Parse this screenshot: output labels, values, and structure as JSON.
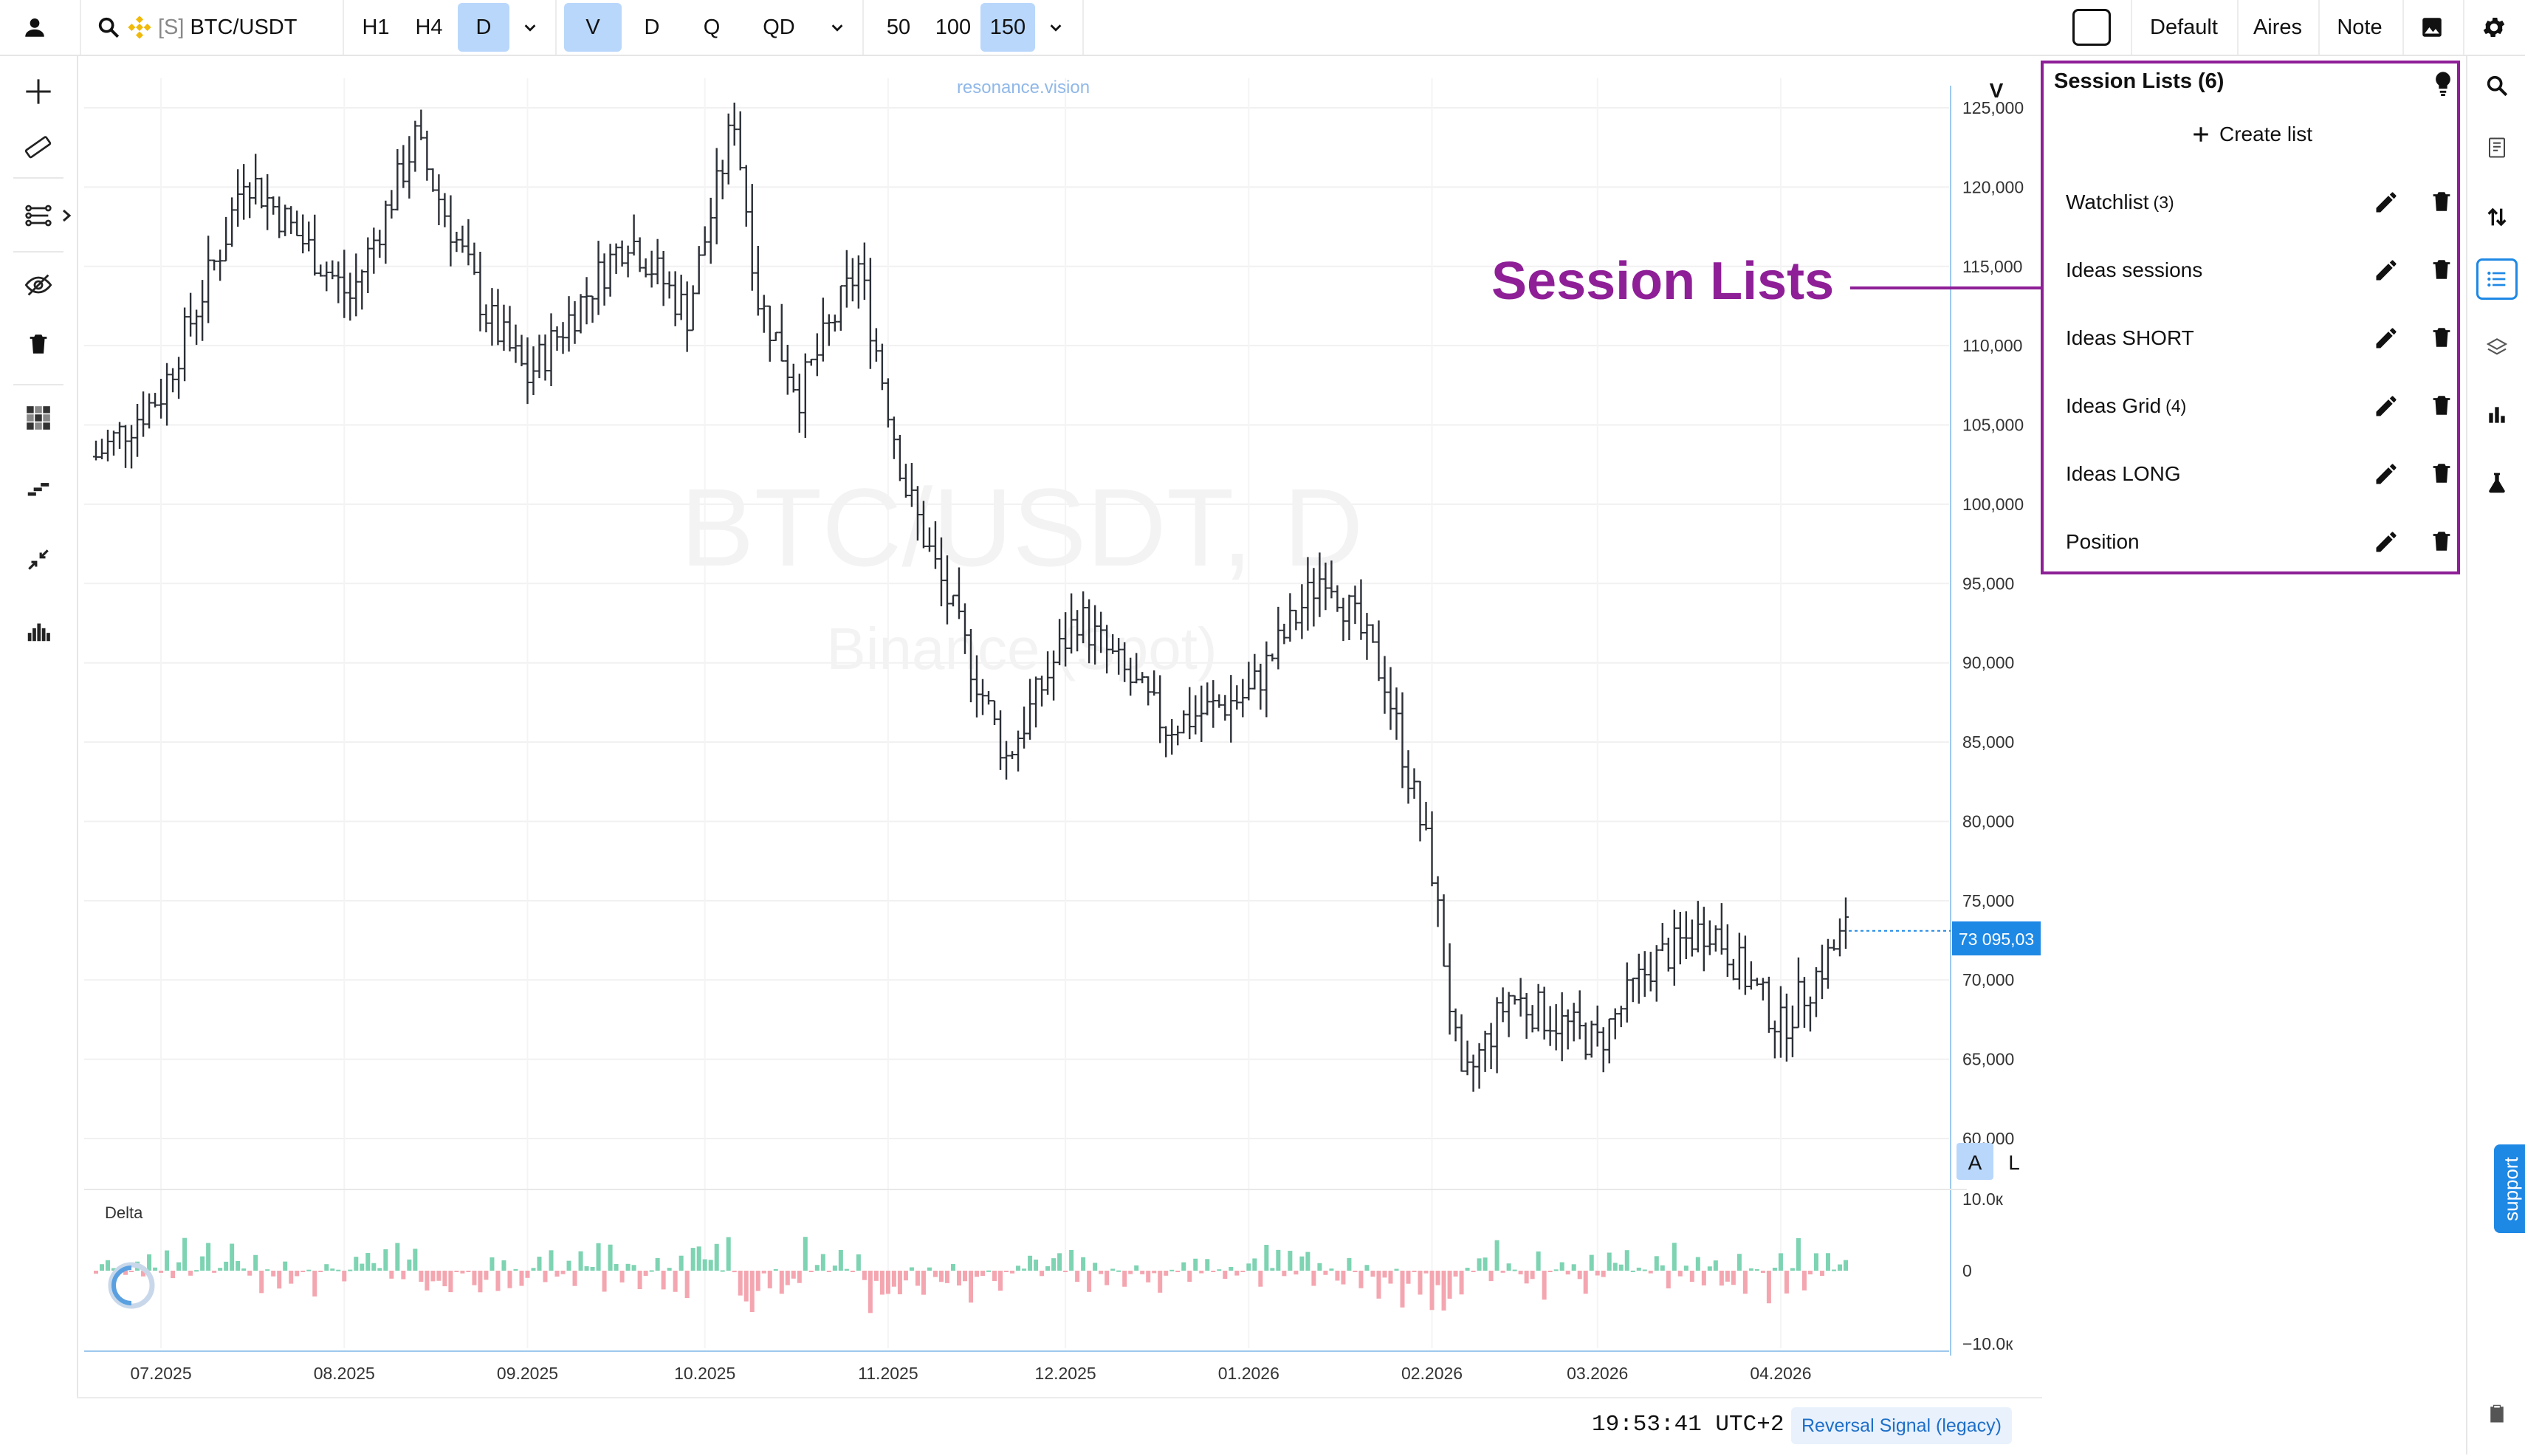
{
  "toolbar": {
    "symbol_prefix": "[S]",
    "symbol": "BTC/USDT",
    "timeframes": [
      "H1",
      "H4",
      "D"
    ],
    "selected_timeframe": "D",
    "chart_modes": [
      "V",
      "D",
      "Q",
      "QD"
    ],
    "selected_mode": "V",
    "counts": [
      "50",
      "100",
      "150"
    ],
    "selected_count": "150",
    "presets": [
      "Default",
      "Aires",
      "Note"
    ]
  },
  "chart": {
    "watermark_site": "resonance.vision",
    "watermark_title": "BTC/USDT, D",
    "watermark_exchange": "Binance (Spot)",
    "price_scale_label": "V",
    "current_price": "73 095,03",
    "delta_label": "Delta",
    "scale_btn_a": "A",
    "scale_btn_l": "L",
    "price_ticks": [
      "125,000",
      "120,000",
      "115,000",
      "110,000",
      "105,000",
      "100,000",
      "95,000",
      "90,000",
      "85,000",
      "80,000",
      "75,000",
      "70,000",
      "65,000",
      "60,000"
    ],
    "delta_ticks": [
      "10.0к",
      "0",
      "−10.0к"
    ],
    "date_ticks": [
      "07.2025",
      "08.2025",
      "09.2025",
      "10.2025",
      "11.2025",
      "12.2025",
      "01.2026",
      "02.2026",
      "03.2026",
      "04.2026"
    ]
  },
  "chart_data": {
    "type": "ohlc",
    "title": "BTC/USDT, D",
    "xlabel": "",
    "ylabel": "",
    "x_range": [
      "2025-06-20",
      "2026-04-20"
    ],
    "ylim": [
      60000,
      127000
    ],
    "anchors": [
      {
        "date": "2025-06-20",
        "price": 103000
      },
      {
        "date": "2025-07-01",
        "price": 107000
      },
      {
        "date": "2025-07-12",
        "price": 117000
      },
      {
        "date": "2025-07-15",
        "price": 121000
      },
      {
        "date": "2025-08-02",
        "price": 113000
      },
      {
        "date": "2025-08-13",
        "price": 123000
      },
      {
        "date": "2025-08-25",
        "price": 112000
      },
      {
        "date": "2025-09-01",
        "price": 108000
      },
      {
        "date": "2025-09-18",
        "price": 117000
      },
      {
        "date": "2025-09-28",
        "price": 112000
      },
      {
        "date": "2025-10-06",
        "price": 124500
      },
      {
        "date": "2025-10-10",
        "price": 113000
      },
      {
        "date": "2025-10-17",
        "price": 107000
      },
      {
        "date": "2025-10-27",
        "price": 115000
      },
      {
        "date": "2025-11-04",
        "price": 101000
      },
      {
        "date": "2025-11-21",
        "price": 84000
      },
      {
        "date": "2025-12-03",
        "price": 93000
      },
      {
        "date": "2025-12-18",
        "price": 86000
      },
      {
        "date": "2026-01-01",
        "price": 88000
      },
      {
        "date": "2026-01-14",
        "price": 96000
      },
      {
        "date": "2026-01-24",
        "price": 89000
      },
      {
        "date": "2026-02-01",
        "price": 77000
      },
      {
        "date": "2026-02-06",
        "price": 63000
      },
      {
        "date": "2026-02-14",
        "price": 69000
      },
      {
        "date": "2026-03-01",
        "price": 66000
      },
      {
        "date": "2026-03-10",
        "price": 71000
      },
      {
        "date": "2026-03-20",
        "price": 73500
      },
      {
        "date": "2026-04-01",
        "price": 67000
      },
      {
        "date": "2026-04-12",
        "price": 73095
      }
    ],
    "delta_ylim": [
      -10000,
      10000
    ],
    "grid": true
  },
  "annotation": {
    "label": "Session Lists",
    "color": "#8e1f97"
  },
  "session_panel": {
    "title": "Session Lists (6)",
    "create_label": "Create list",
    "lists": [
      {
        "name": "Watchlist",
        "count": "(3)"
      },
      {
        "name": "Ideas sessions",
        "count": ""
      },
      {
        "name": "Ideas SHORT",
        "count": ""
      },
      {
        "name": "Ideas Grid",
        "count": "(4)"
      },
      {
        "name": "Ideas LONG",
        "count": ""
      },
      {
        "name": "Position",
        "count": ""
      }
    ]
  },
  "right_toolbar": {
    "support_label": "support"
  },
  "status": {
    "clock": "19:53:41 UTC+2",
    "signal_badge": "Reversal Signal (legacy)"
  },
  "colors": {
    "accent": "#1e88e5",
    "selected_bg": "#b9d7fb",
    "delta_up": "#7dd3b2",
    "delta_down": "#f4a6b0",
    "annotation": "#8e1f97"
  }
}
